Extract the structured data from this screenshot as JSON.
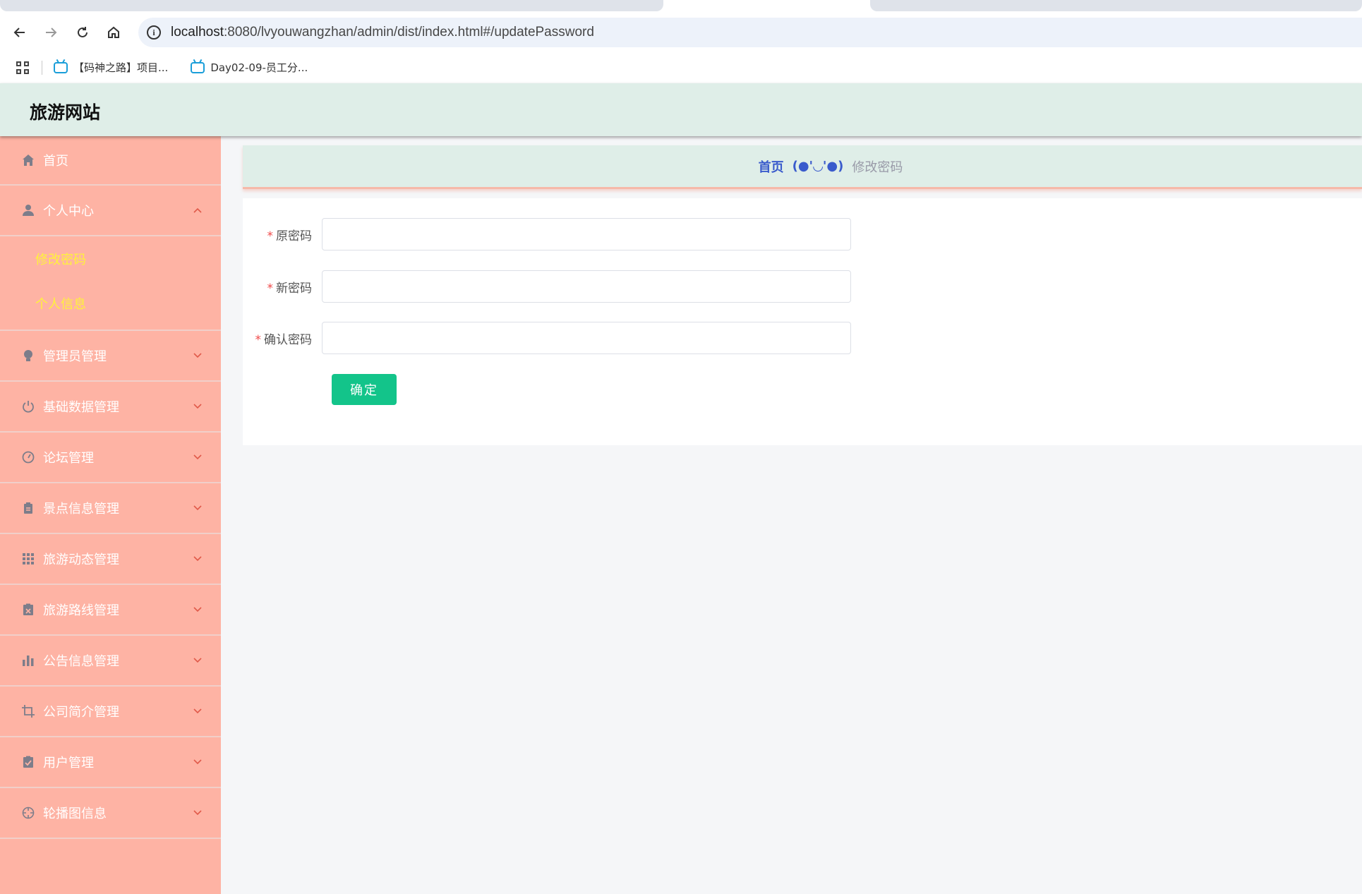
{
  "browser": {
    "url_host": "localhost",
    "url_rest": ":8080/lvyouwangzhan/admin/dist/index.html#/updatePassword",
    "bookmarks": [
      {
        "label": "【码神之路】项目..."
      },
      {
        "label": "Day02-09-员工分..."
      }
    ]
  },
  "header": {
    "title": "旅游网站"
  },
  "sidebar": {
    "items": [
      {
        "label": "首页",
        "icon": "home-icon"
      },
      {
        "label": "个人中心",
        "icon": "user-icon",
        "expanded": true,
        "children": [
          {
            "label": "修改密码"
          },
          {
            "label": "个人信息"
          }
        ]
      },
      {
        "label": "管理员管理",
        "icon": "bulb-icon"
      },
      {
        "label": "基础数据管理",
        "icon": "power-icon"
      },
      {
        "label": "论坛管理",
        "icon": "gauge-icon"
      },
      {
        "label": "景点信息管理",
        "icon": "clipboard-icon"
      },
      {
        "label": "旅游动态管理",
        "icon": "grid-icon"
      },
      {
        "label": "旅游路线管理",
        "icon": "delete-doc-icon"
      },
      {
        "label": "公告信息管理",
        "icon": "bar-chart-icon"
      },
      {
        "label": "公司简介管理",
        "icon": "crop-icon"
      },
      {
        "label": "用户管理",
        "icon": "clipboard-check-icon"
      },
      {
        "label": "轮播图信息",
        "icon": "crosshair-icon"
      }
    ]
  },
  "breadcrumb": {
    "home": "首页",
    "separator": "(●'◡'●)",
    "current": "修改密码"
  },
  "form": {
    "fields": [
      {
        "label": "原密码",
        "required_mark": "*",
        "value": "",
        "placeholder": ""
      },
      {
        "label": "新密码",
        "required_mark": "*",
        "value": "",
        "placeholder": ""
      },
      {
        "label": "确认密码",
        "required_mark": "*",
        "value": "",
        "placeholder": ""
      }
    ],
    "submit_label": "确定"
  },
  "colors": {
    "header_bg": "#dfeee8",
    "sidebar_bg": "#feb3a4",
    "submenu_text": "#fff23b",
    "breadcrumb_home": "#3a5bcc",
    "submit_bg": "#13c48a"
  }
}
